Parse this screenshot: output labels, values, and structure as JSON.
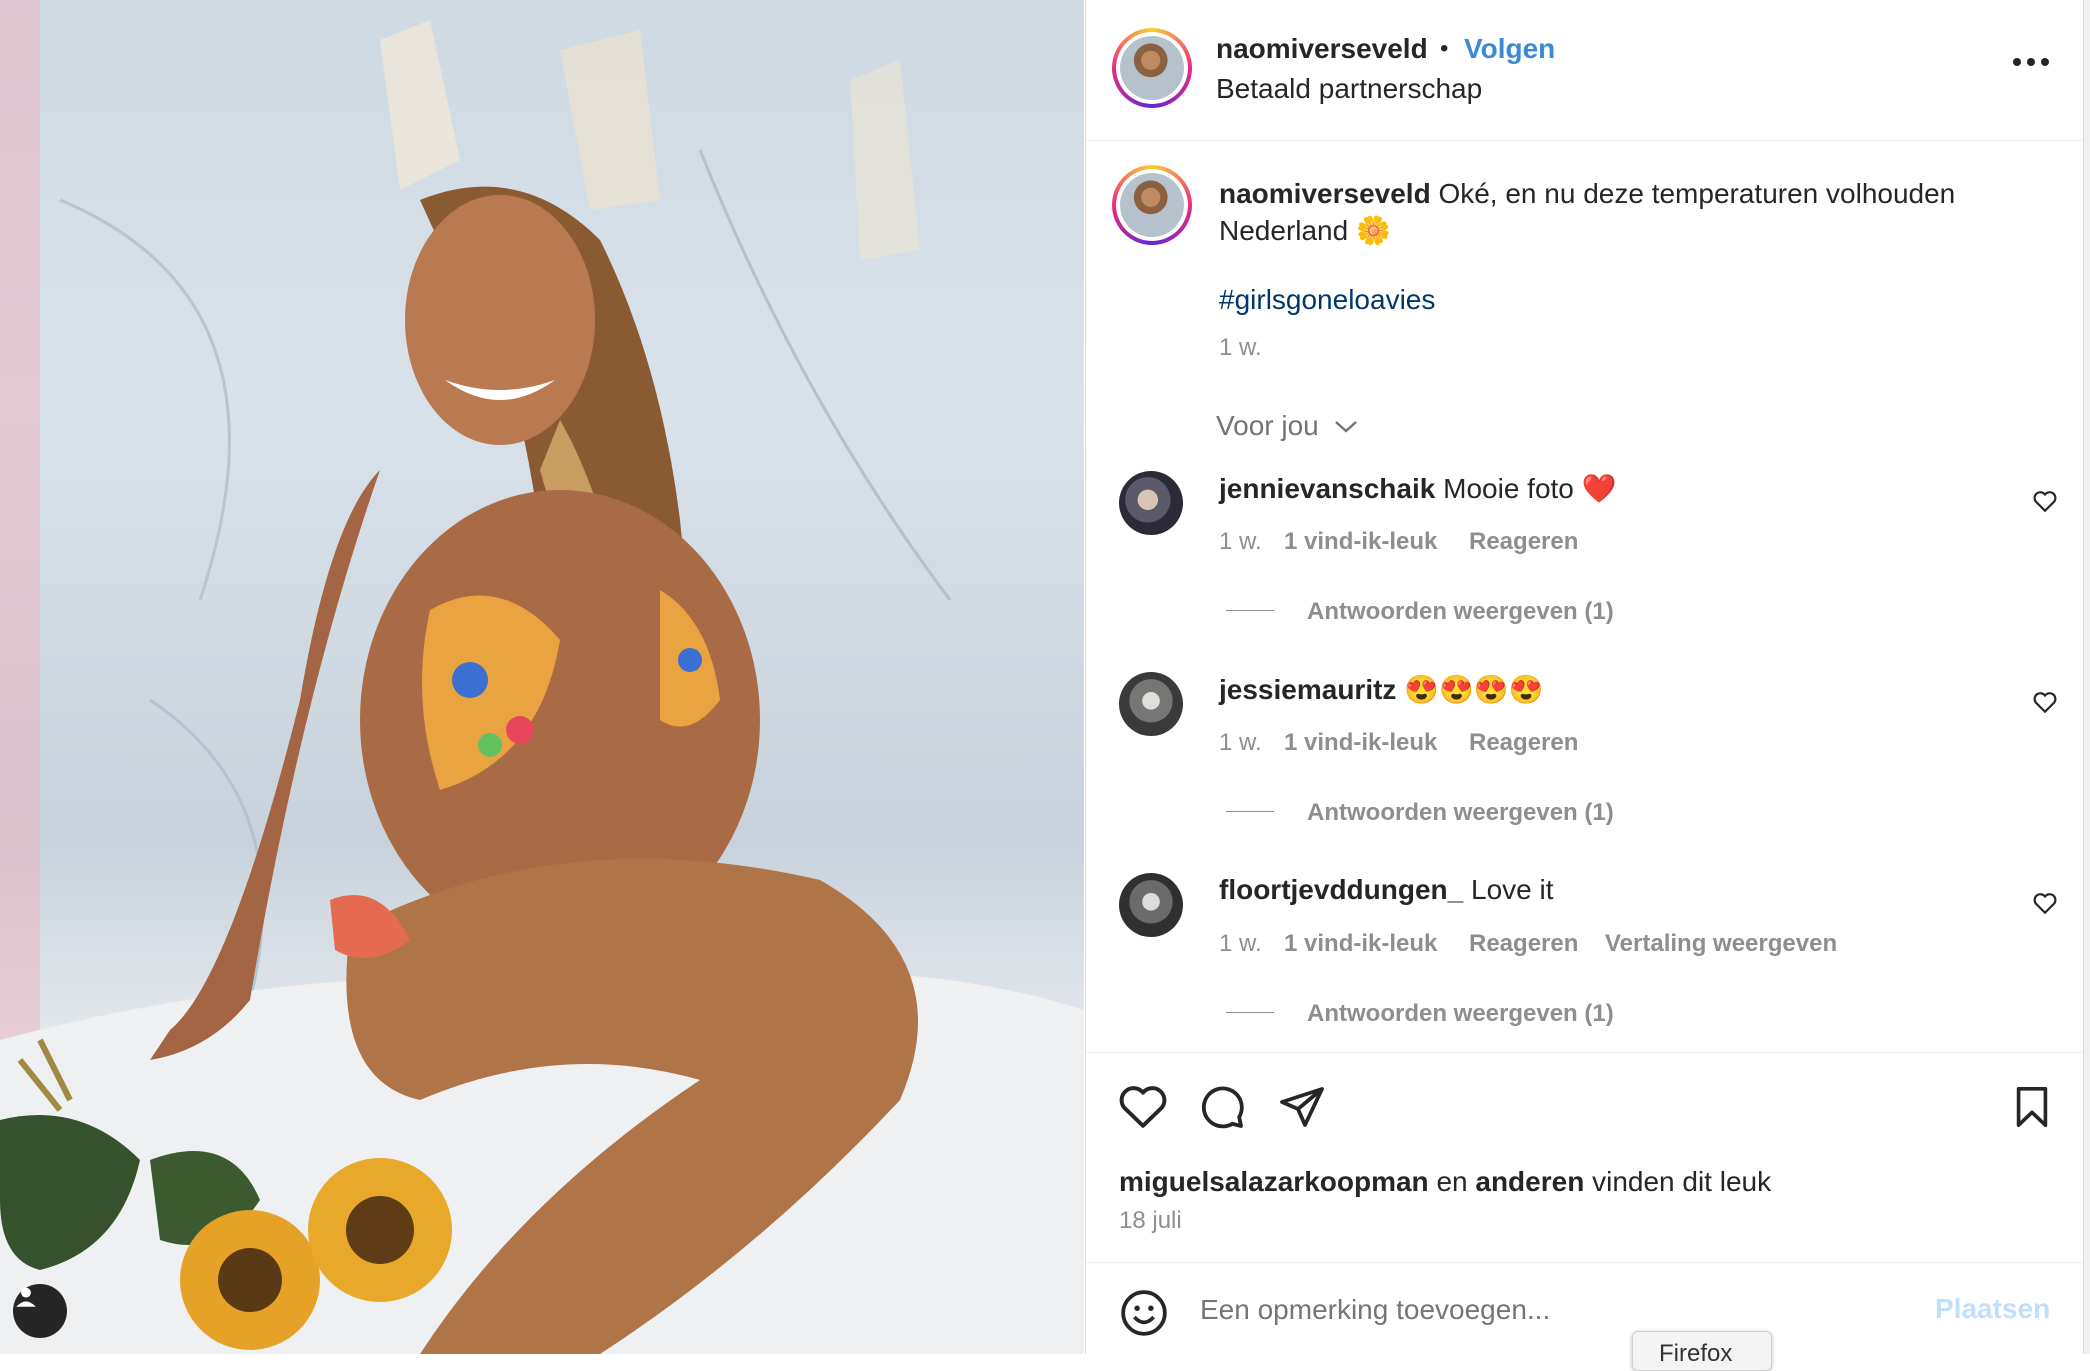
{
  "post": {
    "author": "naomiverseveld",
    "separator": "•",
    "follow_label": "Volgen",
    "subtitle": "Betaald partnerschap",
    "caption_text": "Oké, en nu deze temperaturen volhouden",
    "caption_line2": "Nederland 🌼",
    "hashtag": "#girlsgoneloavies",
    "caption_time": "1 w."
  },
  "comments_section": {
    "sort_label": "Voor jou",
    "comments": [
      {
        "user": "jennievanschaik",
        "text": "Mooie foto ❤️",
        "time": "1 w.",
        "likes": "1 vind-ik-leuk",
        "reply": "Reageren",
        "translate": "",
        "view_replies": "Antwoorden weergeven (1)"
      },
      {
        "user": "jessiemauritz",
        "text": "😍😍😍😍",
        "time": "1 w.",
        "likes": "1 vind-ik-leuk",
        "reply": "Reageren",
        "translate": "",
        "view_replies": "Antwoorden weergeven (1)"
      },
      {
        "user": "floortjevddungen_",
        "text": "Love it",
        "time": "1 w.",
        "likes": "1 vind-ik-leuk",
        "reply": "Reageren",
        "translate": "Vertaling weergeven",
        "view_replies": "Antwoorden weergeven (1)"
      }
    ]
  },
  "likes": {
    "liker": "miguelsalazarkoopman",
    "connector": "en",
    "others": "anderen",
    "suffix": "vinden dit leuk",
    "date": "18 juli"
  },
  "composer": {
    "placeholder": "Een opmerking toevoegen...",
    "submit_label": "Plaatsen"
  },
  "tooltip": {
    "text": "Firefox"
  },
  "icons": [
    "tag-people-icon",
    "more-options-icon",
    "heart-icon",
    "comment-icon",
    "share-icon",
    "bookmark-icon",
    "emoji-icon"
  ],
  "colors": {
    "accent": "#3c89d8",
    "text": "#262626",
    "muted": "#8e8e8e",
    "submit_disabled": "#c0dffd"
  }
}
